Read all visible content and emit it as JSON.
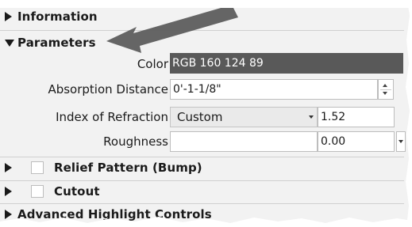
{
  "sections": {
    "information": "Information",
    "parameters": "Parameters",
    "relief": "Relief Pattern (Bump)",
    "cutout": "Cutout",
    "advanced": "Advanced Highlight Controls"
  },
  "fields": {
    "color": {
      "label": "Color",
      "value": "RGB 160 124 89",
      "swatch": "#595959"
    },
    "absorption": {
      "label": "Absorption Distance",
      "value": "0'-1-1/8\""
    },
    "refraction": {
      "label": "Index of Refraction",
      "option": "Custom",
      "value": "1.52"
    },
    "roughness": {
      "label": "Roughness",
      "value": "0.00"
    }
  },
  "checkboxes": {
    "relief_checked": false,
    "cutout_checked": false
  },
  "annotation": {
    "arrow_color": "#595959"
  }
}
